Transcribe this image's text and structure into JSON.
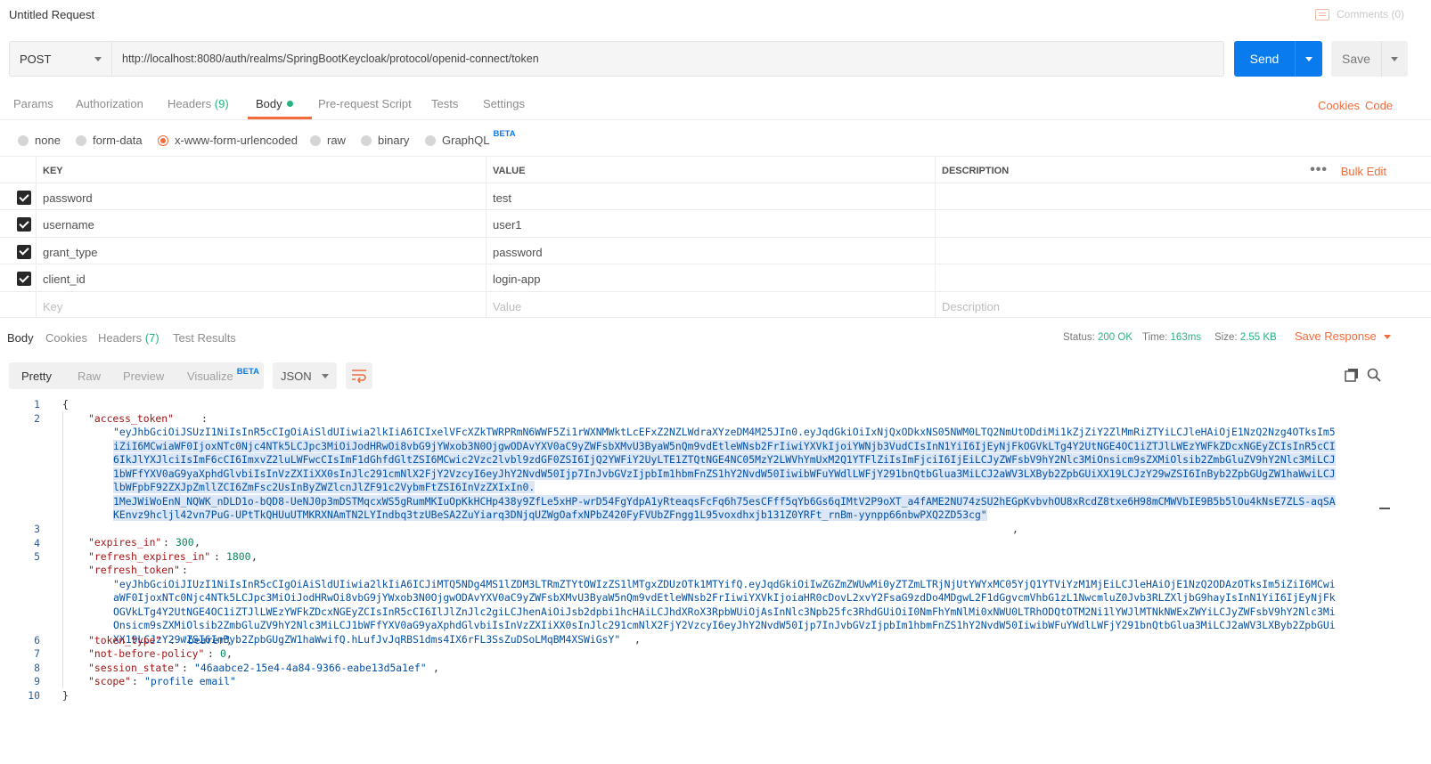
{
  "title_bar": {
    "title": "Untitled Request",
    "comments": "Comments (0)"
  },
  "request": {
    "method": "POST",
    "url": "http://localhost:8080/auth/realms/SpringBootKeycloak/protocol/openid-connect/token",
    "send_label": "Send",
    "save_label": "Save"
  },
  "request_tabs": {
    "params": "Params",
    "authorization": "Authorization",
    "headers": "Headers",
    "headers_count": "(9)",
    "body": "Body",
    "pre_request": "Pre-request Script",
    "tests": "Tests",
    "settings": "Settings",
    "cookies": "Cookies",
    "code": "Code"
  },
  "body_types": {
    "none": "none",
    "form_data": "form-data",
    "urlencoded": "x-www-form-urlencoded",
    "raw": "raw",
    "binary": "binary",
    "graphql": "GraphQL",
    "beta": "BETA",
    "selected": "x-www-form-urlencoded"
  },
  "params_table": {
    "headers": {
      "key": "KEY",
      "value": "VALUE",
      "description": "DESCRIPTION",
      "bulk_edit": "Bulk Edit"
    },
    "rows": [
      {
        "key": "password",
        "value": "test",
        "checked": true
      },
      {
        "key": "username",
        "value": "user1",
        "checked": true
      },
      {
        "key": "grant_type",
        "value": "password",
        "checked": true
      },
      {
        "key": "client_id",
        "value": "login-app",
        "checked": true
      }
    ],
    "placeholders": {
      "key": "Key",
      "value": "Value",
      "description": "Description"
    }
  },
  "response_tabs": {
    "body": "Body",
    "cookies": "Cookies",
    "headers": "Headers",
    "headers_count": "(7)",
    "test_results": "Test Results",
    "status_label": "Status:",
    "status_value": "200 OK",
    "time_label": "Time:",
    "time_value": "163ms",
    "size_label": "Size:",
    "size_value": "2.55 KB",
    "save_response": "Save Response"
  },
  "view_toolbar": {
    "pretty": "Pretty",
    "raw": "Raw",
    "preview": "Preview",
    "visualize": "Visualize",
    "beta": "BETA",
    "format": "JSON"
  },
  "code": {
    "line_numbers": [
      "1",
      "2",
      "3",
      "4",
      "5",
      "6",
      "7",
      "8",
      "9",
      "10"
    ],
    "open_brace": "{",
    "close_brace": "}",
    "access_token_key": "\"access_token\"",
    "access_token_lines": [
      "\"eyJhbGciOiJSUzI1NiIsInR5cCIgOiAiSldUIiwia2lkIiA6ICIxelVFcXZkTWRPRmN6WWF5Zi1rWXNMWktLcEFxZ2NZLWdraXYzeDM4M25JIn0.eyJqdGkiOiIxNjQxODkxNS05NWM0LTQ2NmUtODdiMi1kZjZiY2ZlMmRiZTYiLCJleHAiOjE1NzQ2Nzg4OTksIm5",
      "iZiI6MCwiaWF0IjoxNTc0Njc4NTk5LCJpc3MiOiJodHRwOi8vbG9jYWxob3N0OjgwODAvYXV0aC9yZWFsbXMvU3ByaW5nQm9vdEtleWNsb2FrIiwiYXVkIjoiYWNjb3VudCIsInN1YiI6IjEyNjFkOGVkLTg4Y2UtNGE4OC1iZTJlLWEzYWFkZDcxNGEyZCIsInR5cCI",
      "6IkJlYXJlciIsImF6cCI6ImxvZ2luLWFwcCIsImF1dGhfdGltZSI6MCwic2Vzc2lvbl9zdGF0ZSI6IjQ2YWFiY2UyLTE1ZTQtNGE4NC05MzY2LWVhYmUxM2Q1YTFlZiIsImFjciI6IjEiLCJyZWFsbV9hY2Nlc3MiOnsicm9sZXMiOlsib2ZmbGluZV9hY2Nlc3MiLCJ",
      "1bWFfYXV0aG9yaXphdGlvbiIsInVzZXIiXX0sInJlc291cmNlX2FjY2VzcyI6eyJhY2NvdW50Ijp7InJvbGVzIjpbIm1hbmFnZS1hY2NvdW50IiwibWFuYWdlLWFjY291bnQtbGlua3MiLCJ2aWV3LXByb2ZpbGUiXX19LCJzY29wZSI6InByb2ZpbGUgZW1haWwiLCJ",
      "lbWFpbF92ZXJpZmllZCI6ZmFsc2UsInByZWZlcnJlZF91c2VybmFtZSI6InVzZXIxIn0.",
      "1MeJWiWoEnN_NQWK_nDLD1o-bQD8-UeNJ0p3mDSTMqcxWS5gRumMKIuOpKkHCHp438y9ZfLe5xHP-wrD54FgYdpA1yRteaqsFcFq6h75esCFff5qYb6Gs6qIMtV2P9oXT_a4fAME2NU74zSU2hEGpKvbvhOU8xRcdZ8txe6H98mCMWVbIE9B5b5lOu4kNsE7ZLS-aqSA",
      "KEnvz9hcljl42vn7PuG-UPtTkQHUuUTMKRXNAmTN2LYIndbq3tzUBeSA2ZuYiarq3DNjqUZWgOafxNPbZ420FyFVUbZFngg1L95voxdhxjb131Z0YRFt_rnBm-yynpp66nbwPXQ2ZD53cg\""
    ],
    "expires_in_key": "\"expires_in\"",
    "expires_in_value": "300",
    "refresh_expires_in_key": "\"refresh_expires_in\"",
    "refresh_expires_in_value": "1800",
    "refresh_token_key": "\"refresh_token\"",
    "refresh_token_lines": [
      "\"eyJhbGciOiJIUzI1NiIsInR5cCIgOiAiSldUIiwia2lkIiA6ICJiMTQ5NDg4MS1lZDM3LTRmZTYtOWIzZS1lMTgxZDUzOTk1MTYifQ.eyJqdGkiOiIwZGZmZWUwMi0yZTZmLTRjNjUtYWYxMC05YjQ1YTViYzM1MjEiLCJleHAiOjE1NzQ2ODAzOTksIm5iZiI6MCwi",
      "aWF0IjoxNTc0Njc4NTk5LCJpc3MiOiJodHRwOi8vbG9jYWxob3N0OjgwODAvYXV0aC9yZWFsbXMvU3ByaW5nQm9vdEtleWNsb2FrIiwiYXVkIjoiaHR0cDovL2xvY2FsaG9zdDo4MDgwL2F1dGgvcmVhbG1zL1NwcmluZ0Jvb3RLZXljbG9hayIsInN1YiI6IjEyNjFk",
      "OGVkLTg4Y2UtNGE4OC1iZTJlLWEzYWFkZDcxNGEyZCIsInR5cCI6IlJlZnJlc2giLCJhenAiOiJsb2dpbi1hcHAiLCJhdXRoX3RpbWUiOjAsInNlc3Npb25fc3RhdGUiOiI0NmFhYmNlMi0xNWU0LTRhODQtOTM2Ni1lYWJlMTNkNWExZWYiLCJyZWFsbV9hY2Nlc3Mi",
      "Onsicm9sZXMiOlsib2ZmbGluZV9hY2Nlc3MiLCJ1bWFfYXV0aG9yaXphdGlvbiIsInVzZXIiXX0sInJlc291cmNlX2FjY2VzcyI6eyJhY2NvdW50Ijp7InJvbGVzIjpbIm1hbmFnZS1hY2NvdW50IiwibWFuYWdlLWFjY291bnQtbGlua3MiLCJ2aWV3LXByb2ZpbGUi",
      "XX19LCJzY29wZSI6InByb2ZpbGUgZW1haWwifQ.hLufJvJqRBS1dms4IX6rFL3SsZuDSoLMqBM4XSWiGsY\""
    ],
    "token_type_key": "\"token_type\"",
    "token_type_value": "\"bearer\"",
    "not_before_key": "\"not-before-policy\"",
    "not_before_value": "0",
    "session_state_key": "\"session_state\"",
    "session_state_value": "\"46aabce2-15e4-4a84-9366-eabe13d5a1ef\"",
    "scope_key": "\"scope\"",
    "scope_value": "\"profile email\""
  }
}
